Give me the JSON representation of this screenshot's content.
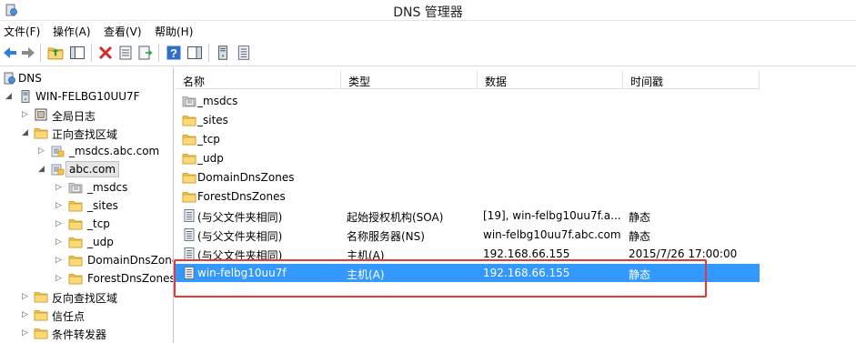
{
  "window": {
    "title": "DNS 管理器",
    "app_icon": "dns-console-icon"
  },
  "menu": [
    "文件(F)",
    "操作(A)",
    "查看(V)",
    "帮助(H)"
  ],
  "toolbar": [
    "back-arrow-icon",
    "forward-arrow-icon",
    "up-folder-icon",
    "show-console-tree-icon",
    "delete-icon",
    "properties-icon",
    "export-list-icon",
    "help-icon",
    "show-action-pane-icon",
    "server-icon",
    "record-list-icon"
  ],
  "tree": [
    {
      "label": "DNS",
      "icon": "dns-icon",
      "expander": ""
    },
    {
      "label": "WIN-FELBG10UU7F",
      "icon": "server-icon",
      "expander": "◢"
    },
    {
      "label": "全局日志",
      "icon": "log-icon",
      "expander": "▷"
    },
    {
      "label": "正向查找区域",
      "icon": "folder-icon",
      "expander": "◢"
    },
    {
      "label": "_msdcs.abc.com",
      "icon": "zone-icon",
      "expander": "▷"
    },
    {
      "label": "abc.com",
      "icon": "zone-icon",
      "expander": "◢"
    },
    {
      "label": "_msdcs",
      "icon": "delegated-folder-icon",
      "expander": "▷"
    },
    {
      "label": "_sites",
      "icon": "folder-icon",
      "expander": "▷"
    },
    {
      "label": "_tcp",
      "icon": "folder-icon",
      "expander": "▷"
    },
    {
      "label": "_udp",
      "icon": "folder-icon",
      "expander": "▷"
    },
    {
      "label": "DomainDnsZones",
      "icon": "folder-icon",
      "expander": "▷"
    },
    {
      "label": "ForestDnsZones",
      "icon": "folder-icon",
      "expander": "▷"
    },
    {
      "label": "反向查找区域",
      "icon": "folder-icon",
      "expander": "▷"
    },
    {
      "label": "信任点",
      "icon": "folder-icon",
      "expander": "▷"
    },
    {
      "label": "条件转发器",
      "icon": "folder-icon",
      "expander": "▷"
    }
  ],
  "columns": [
    "名称",
    "类型",
    "数据",
    "时间戳"
  ],
  "rows": [
    {
      "icon": "delegated-folder-icon",
      "name": "_msdcs",
      "type": "",
      "data": "",
      "timestamp": ""
    },
    {
      "icon": "folder-icon",
      "name": "_sites",
      "type": "",
      "data": "",
      "timestamp": ""
    },
    {
      "icon": "folder-icon",
      "name": "_tcp",
      "type": "",
      "data": "",
      "timestamp": ""
    },
    {
      "icon": "folder-icon",
      "name": "_udp",
      "type": "",
      "data": "",
      "timestamp": ""
    },
    {
      "icon": "folder-icon",
      "name": "DomainDnsZones",
      "type": "",
      "data": "",
      "timestamp": ""
    },
    {
      "icon": "folder-icon",
      "name": "ForestDnsZones",
      "type": "",
      "data": "",
      "timestamp": ""
    },
    {
      "icon": "record-icon",
      "name": "(与父文件夹相同)",
      "type": "起始授权机构(SOA)",
      "data": "[19], win-felbg10uu7f.a...",
      "timestamp": "静态"
    },
    {
      "icon": "record-icon",
      "name": "(与父文件夹相同)",
      "type": "名称服务器(NS)",
      "data": "win-felbg10uu7f.abc.com.",
      "timestamp": "静态"
    },
    {
      "icon": "record-icon",
      "name": "(与父文件夹相同)",
      "type": "主机(A)",
      "data": "192.168.66.155",
      "timestamp": "2015/7/26 17:00:00"
    },
    {
      "icon": "record-icon",
      "name": "win-felbg10uu7f",
      "type": "主机(A)",
      "data": "192.168.66.155",
      "timestamp": "静态",
      "selected": true
    }
  ],
  "colors": {
    "selection": "#3399ff",
    "highlight_border": "#e53935",
    "folder": "#f4c542"
  }
}
